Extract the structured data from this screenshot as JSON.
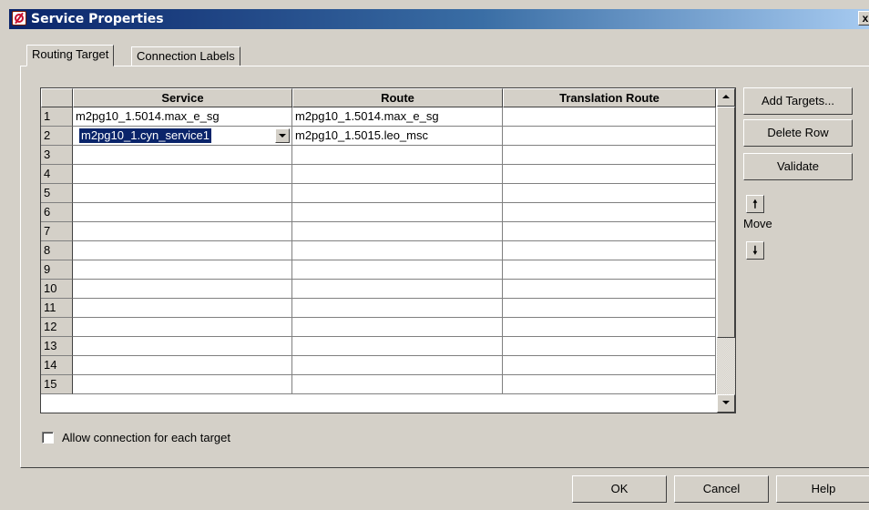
{
  "window": {
    "title": "Service Properties",
    "close_label": "x"
  },
  "tabs": [
    {
      "label": "Routing Target",
      "active": true
    },
    {
      "label": "Connection Labels",
      "active": false
    }
  ],
  "grid": {
    "columns": [
      "Service",
      "Route",
      "Translation Route"
    ],
    "rows": [
      {
        "num": "1",
        "service": "m2pg10_1.5014.max_e_sg",
        "route": "m2pg10_1.5014.max_e_sg",
        "translation": ""
      },
      {
        "num": "2",
        "service": "m2pg10_1.cyn_service1",
        "route": "m2pg10_1.5015.leo_msc",
        "translation": "",
        "editing": true
      },
      {
        "num": "3",
        "service": "",
        "route": "",
        "translation": ""
      },
      {
        "num": "4",
        "service": "",
        "route": "",
        "translation": ""
      },
      {
        "num": "5",
        "service": "",
        "route": "",
        "translation": ""
      },
      {
        "num": "6",
        "service": "",
        "route": "",
        "translation": ""
      },
      {
        "num": "7",
        "service": "",
        "route": "",
        "translation": ""
      },
      {
        "num": "8",
        "service": "",
        "route": "",
        "translation": ""
      },
      {
        "num": "9",
        "service": "",
        "route": "",
        "translation": ""
      },
      {
        "num": "10",
        "service": "",
        "route": "",
        "translation": ""
      },
      {
        "num": "11",
        "service": "",
        "route": "",
        "translation": ""
      },
      {
        "num": "12",
        "service": "",
        "route": "",
        "translation": ""
      },
      {
        "num": "13",
        "service": "",
        "route": "",
        "translation": ""
      },
      {
        "num": "14",
        "service": "",
        "route": "",
        "translation": ""
      },
      {
        "num": "15",
        "service": "",
        "route": "",
        "translation": ""
      }
    ]
  },
  "side_buttons": {
    "add_targets": "Add Targets...",
    "delete_row": "Delete Row",
    "validate": "Validate",
    "move_label": "Move",
    "move_up": "🠕",
    "move_down": "🠗"
  },
  "checkbox": {
    "label": "Allow connection for each target",
    "checked": false
  },
  "footer": {
    "ok": "OK",
    "cancel": "Cancel",
    "help": "Help"
  },
  "colors": {
    "face": "#d4d0c8",
    "title_start": "#0a246a",
    "title_end": "#a6caf0",
    "selection": "#0a246a"
  }
}
